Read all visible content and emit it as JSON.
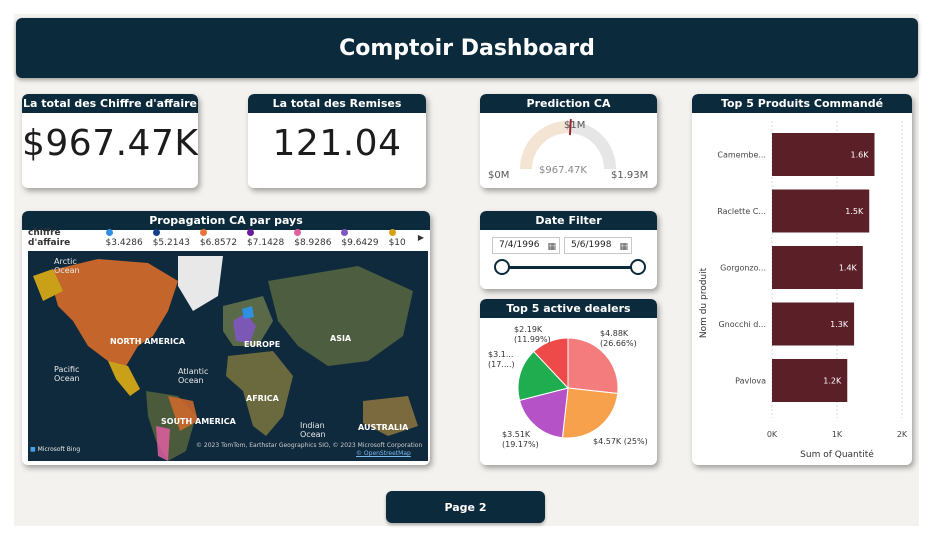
{
  "header": {
    "title": "Comptoir Dashboard"
  },
  "kpi_ca": {
    "title": "La total des Chiffre d'affaire",
    "value": "$967.47K"
  },
  "kpi_remises": {
    "title": "La total des Remises",
    "value": "121.04"
  },
  "prediction": {
    "title": "Prediction CA",
    "value_label": "$967.47K",
    "target_label": "$1M",
    "min_label": "$0M",
    "max_label": "$1.93M",
    "fraction": 0.501,
    "target_fraction": 0.518
  },
  "top_produits": {
    "title": "Top 5 Produits Commandé",
    "ylabel": "Nom du produit",
    "xlabel": "Sum of Quantité",
    "color": "#5a1f27"
  },
  "map": {
    "title": "Propagation CA par pays",
    "legend_title": "chiffre d'affaire",
    "legend": [
      {
        "label": "$3.4286",
        "color": "#2f8fe0"
      },
      {
        "label": "$5.2143",
        "color": "#14408a"
      },
      {
        "label": "$6.8572",
        "color": "#e8743b"
      },
      {
        "label": "$7.1428",
        "color": "#6a1b9a"
      },
      {
        "label": "$8.9286",
        "color": "#e05fa0"
      },
      {
        "label": "$9.6429",
        "color": "#7e57c2"
      },
      {
        "label": "$10",
        "color": "#d4a017"
      }
    ],
    "labels": {
      "arctic": "Arctic\nOcean",
      "north_america": "NORTH AMERICA",
      "europe": "EUROPE",
      "asia": "ASIA",
      "pacific": "Pacific\nOcean",
      "atlantic": "Atlantic\nOcean",
      "africa": "AFRICA",
      "south_america": "SOUTH AMERICA",
      "indian": "Indian\nOcean",
      "australia": "AUSTRALIA"
    },
    "bing": "Microsoft Bing",
    "copyright": "© 2023 TomTom, Earthstar Geographics SIO, © 2023 Microsoft Corporation",
    "osm": "© OpenStreetMap"
  },
  "date_filter": {
    "title": "Date Filter",
    "start": "7/4/1996",
    "end": "5/6/1998"
  },
  "dealers": {
    "title": "Top 5 active dealers",
    "labels": [
      {
        "text": "$4.88K\n(26.66%)"
      },
      {
        "text": "$4.57K (25%)"
      },
      {
        "text": "$3.51K\n(19.17%)"
      },
      {
        "text": "$3.1...\n(17....)"
      },
      {
        "text": "$2.19K\n(11.99%)"
      }
    ]
  },
  "page_button": {
    "label": "Page 2"
  },
  "chart_data": [
    {
      "type": "bar",
      "orientation": "horizontal",
      "title": "Top 5 Produits Commandé",
      "categories": [
        "Camembe...",
        "Raclette C...",
        "Gorgonzo...",
        "Gnocchi d...",
        "Pavlova"
      ],
      "values": [
        1577,
        1496,
        1397,
        1263,
        1158
      ],
      "data_labels": [
        "1.6K",
        "1.5K",
        "1.4K",
        "1.3K",
        "1.2K"
      ],
      "xlim": [
        0,
        2000
      ],
      "xticks": [
        "0K",
        "1K",
        "2K"
      ],
      "xlabel": "Sum of Quantité",
      "ylabel": "Nom du produit",
      "grid": true
    },
    {
      "type": "pie",
      "title": "Top 5 active dealers",
      "values": [
        4.88,
        4.57,
        3.51,
        3.1,
        2.19
      ],
      "percents": [
        26.66,
        25.0,
        19.17,
        17.18,
        11.99
      ],
      "colors": [
        "#f47c7c",
        "#f8a14d",
        "#b552c7",
        "#1fad4f",
        "#ee4a4a"
      ]
    }
  ]
}
